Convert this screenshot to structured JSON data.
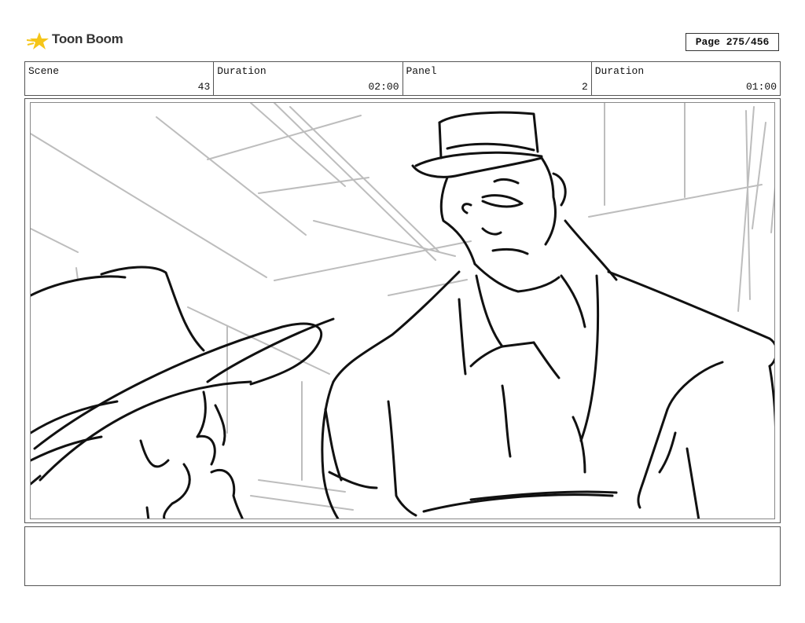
{
  "header": {
    "logo_text": "Toon Boom",
    "page_label": "Page 275/456"
  },
  "info": {
    "scene_label": "Scene",
    "scene_value": "43",
    "scene_duration_label": "Duration",
    "scene_duration_value": "02:00",
    "panel_label": "Panel",
    "panel_value": "2",
    "panel_duration_label": "Duration",
    "panel_duration_value": "01:00"
  },
  "notes": {
    "text": ""
  },
  "colors": {
    "ink": "#111111",
    "construction": "#bdbdbd",
    "logo_accent": "#f5c518"
  }
}
